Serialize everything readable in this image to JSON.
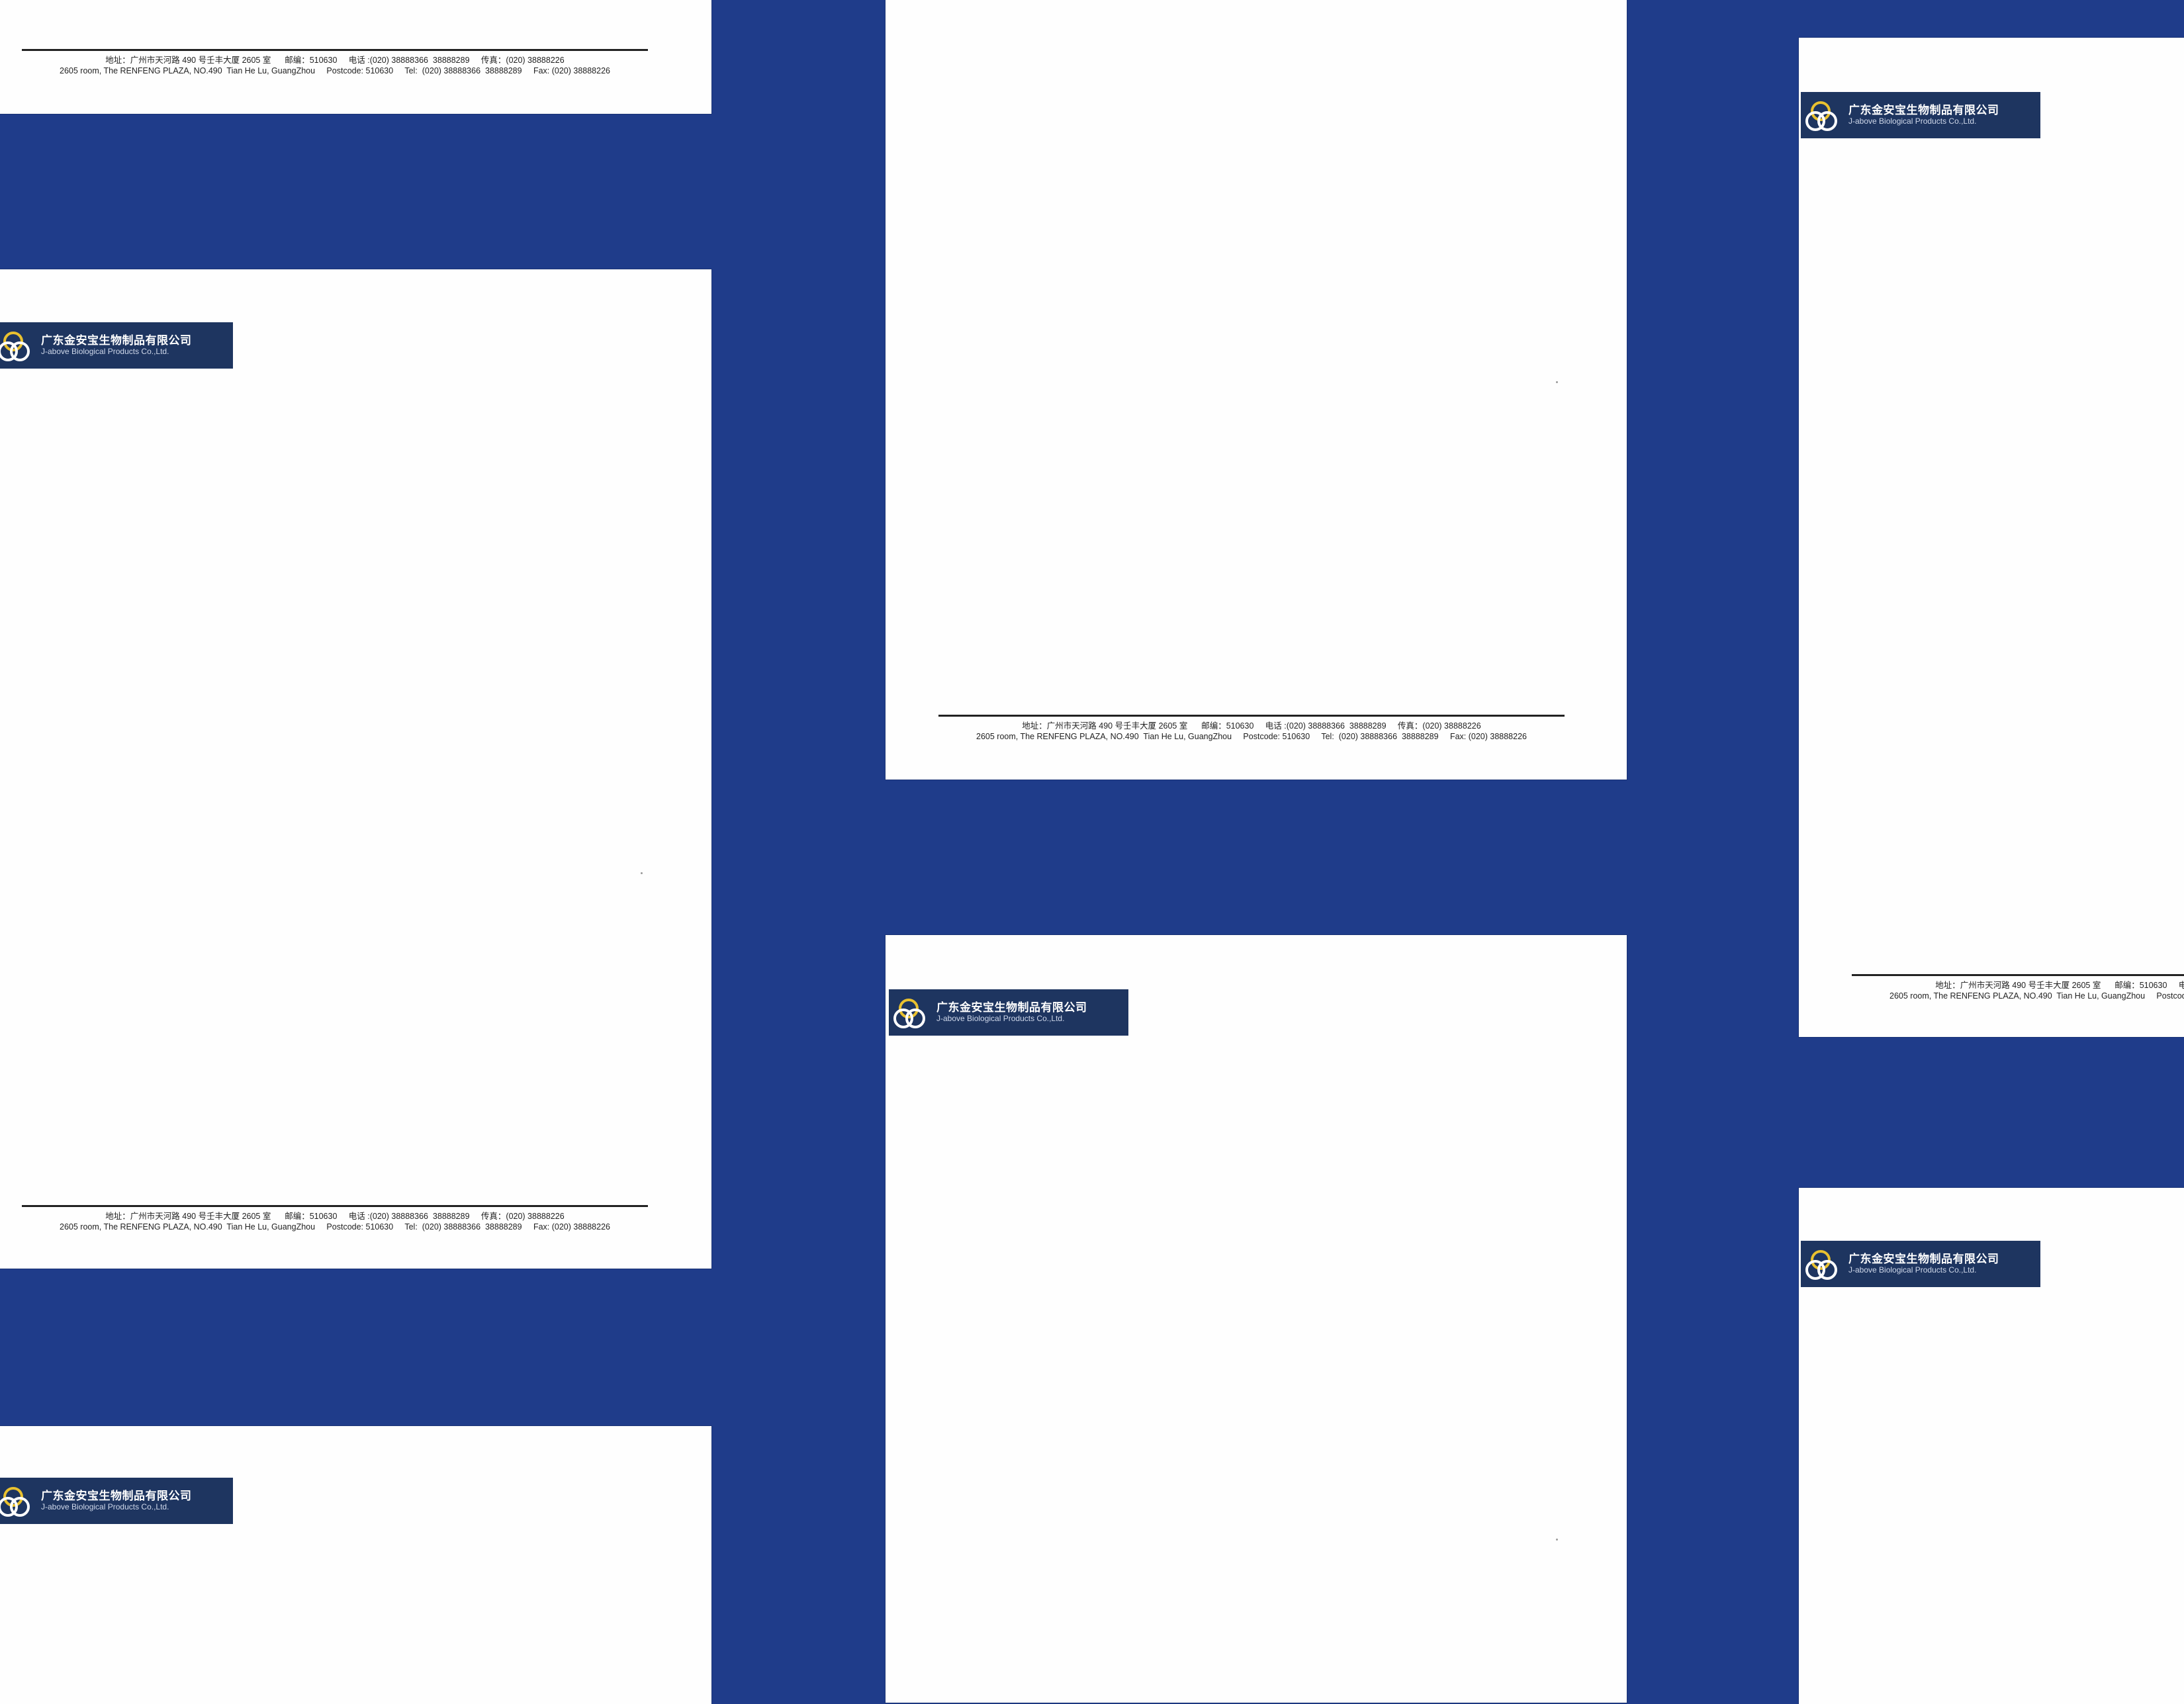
{
  "letterhead": {
    "company_cn": "广东金安宝生物制品有限公司",
    "company_en": "J-above  Biological  Products  Co.,Ltd.",
    "address_cn": "地址：广州市天河路 490 号壬丰大厦 2605 室      邮编：510630     电话 :(020) 38888366  38888289     传真：(020) 38888226",
    "address_en": "2605 room, The RENFENG PLAZA, NO.490  Tian He Lu, GuangZhou     Postcode: 510630     Tel:  (020) 38888366  38888289     Fax: (020) 38888226"
  },
  "colors": {
    "background": "#1f3c8a",
    "paper": "#fefefe",
    "logo_band": "#1e3560"
  },
  "icons": [
    "company-logo-icon"
  ]
}
